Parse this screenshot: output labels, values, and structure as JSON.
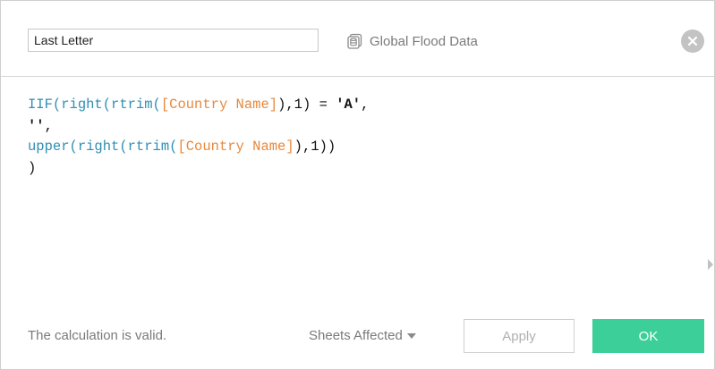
{
  "header": {
    "calculation_name": "Last Letter",
    "datasource_name": "Global Flood Data",
    "datasource_icon": "datasource-icon",
    "close_icon": "close-icon"
  },
  "editor": {
    "lines": [
      [
        {
          "text": "IIF(",
          "kind": "fn"
        },
        {
          "text": "right(",
          "kind": "fn"
        },
        {
          "text": "rtrim(",
          "kind": "fn"
        },
        {
          "text": "[Country Name]",
          "kind": "fld"
        },
        {
          "text": "),1) = ",
          "kind": "punc"
        },
        {
          "text": "'A'",
          "kind": "str"
        },
        {
          "text": ",",
          "kind": "punc"
        }
      ],
      [
        {
          "text": "''",
          "kind": "str"
        },
        {
          "text": ",",
          "kind": "punc"
        }
      ],
      [
        {
          "text": "upper(",
          "kind": "fn"
        },
        {
          "text": "right(",
          "kind": "fn"
        },
        {
          "text": "rtrim(",
          "kind": "fn"
        },
        {
          "text": "[Country Name]",
          "kind": "fld"
        },
        {
          "text": "),1))",
          "kind": "punc"
        }
      ],
      [
        {
          "text": ")",
          "kind": "punc"
        }
      ]
    ]
  },
  "footer": {
    "status_text": "The calculation is valid.",
    "sheets_affected_label": "Sheets Affected",
    "apply_label": "Apply",
    "ok_label": "OK"
  },
  "colors": {
    "function": "#2f8fb2",
    "field": "#e8883c",
    "ok_button": "#3dcf9a",
    "close_button": "#c3c3c3"
  }
}
